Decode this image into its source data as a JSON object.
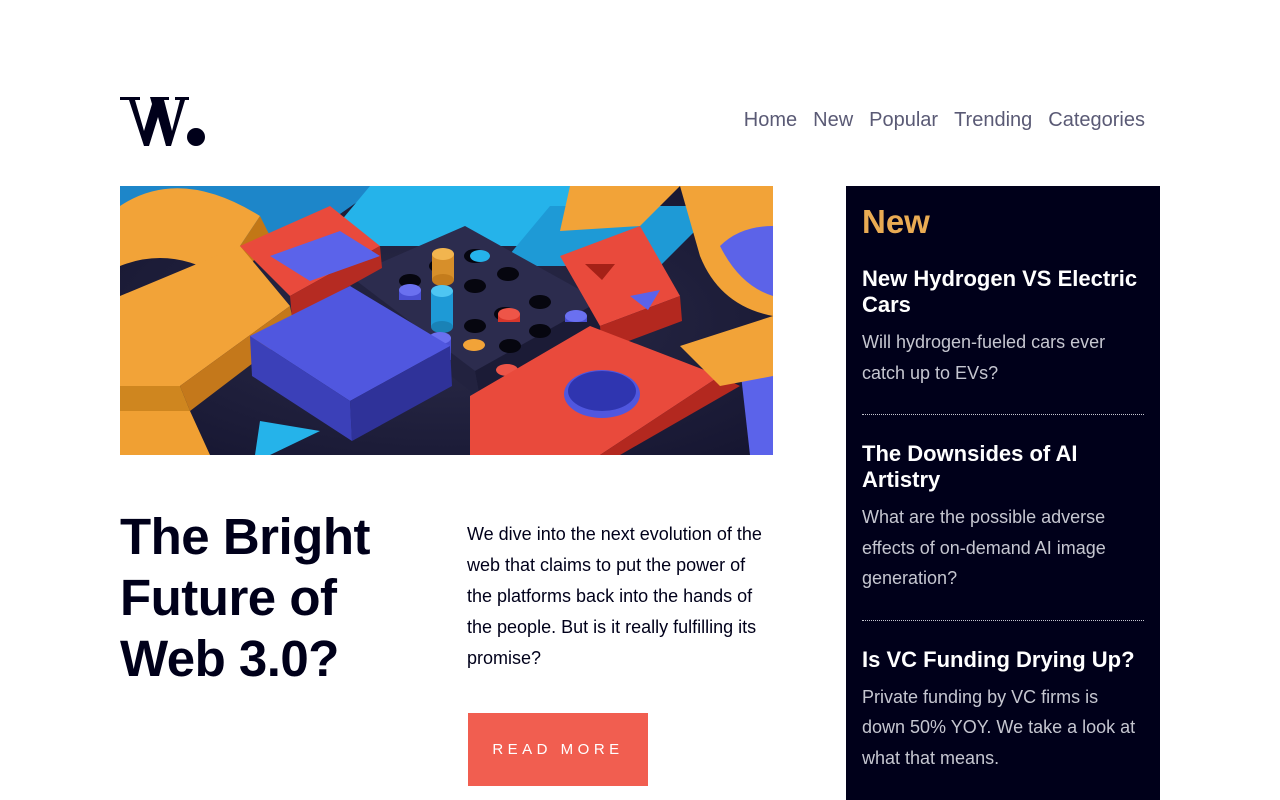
{
  "brand": {
    "logo_text": "W."
  },
  "nav": {
    "items": [
      "Home",
      "New",
      "Popular",
      "Trending",
      "Categories"
    ]
  },
  "hero": {
    "image_alt": "Colorful 3D block puzzle illustration",
    "headline": "The Bright Future of Web 3.0?",
    "intro": "We dive into the next evolution of the web that claims to put the power of the platforms back into the hands of the people. But is it really fulfilling its promise?",
    "button_label": "Read more"
  },
  "sidebar": {
    "title": "New",
    "items": [
      {
        "title": "New Hydrogen VS Electric Cars",
        "summary": "Will hydrogen-fueled cars ever catch up to EVs?"
      },
      {
        "title": "The Downsides of AI Artistry",
        "summary": "What are the possible adverse effects of on-demand AI image generation?"
      },
      {
        "title": "Is VC Funding Drying Up?",
        "summary": "Private funding by VC firms is down 50% YOY. We take a look at what that means."
      }
    ]
  },
  "colors": {
    "primary": "#00001a",
    "accent_red": "#f15e50",
    "accent_orange": "#e9ab53",
    "nav_text": "#5a5a75",
    "muted_text": "#c5c6d0",
    "background": "#ffffff"
  }
}
